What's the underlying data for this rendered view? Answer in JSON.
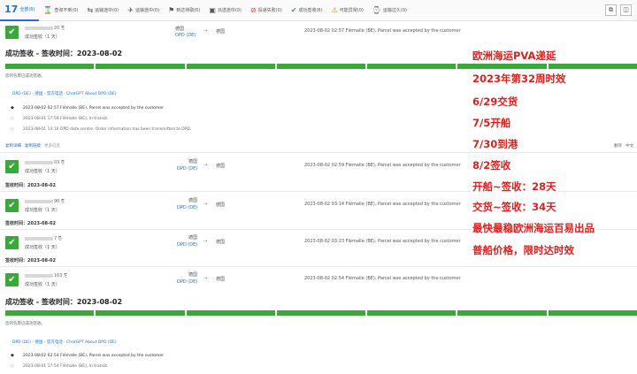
{
  "tabs": [
    {
      "icon": "17",
      "label": "全部(6)",
      "active": true
    },
    {
      "icon": "⌛",
      "label": "查询不到(0)"
    },
    {
      "icon": "⇆",
      "label": "运输途中(0)"
    },
    {
      "icon": "✈",
      "label": "运输途中(0)"
    },
    {
      "icon": "⚑",
      "label": "到达待取(0)"
    },
    {
      "icon": "▣",
      "label": "派送途中(0)"
    },
    {
      "icon": "⊘",
      "label": "投递失败(0)"
    },
    {
      "icon": "✔",
      "label": "成功签收(6)"
    },
    {
      "icon": "⚠",
      "label": "可能异常(0)"
    },
    {
      "icon": "⌚",
      "label": "运输过久(0)"
    }
  ],
  "rows": [
    {
      "num_suffix": "20",
      "status": "成功签收（1 天）",
      "origin": "德国",
      "carrier": "DPD (DE)",
      "dest": "德国",
      "event": "2023-08-02 02:57  Flémalle (BE), Parcel was accepted by the customer"
    },
    {
      "num_suffix": "03",
      "status": "成功签收（1 天）",
      "origin": "德国",
      "carrier": "DPD (DE)",
      "dest": "德国",
      "event": "2023-08-02 02:59  Flémalle (BE), Parcel was accepted by the customer"
    },
    {
      "num_suffix": "90",
      "status": "成功签收（1 天）",
      "origin": "德国",
      "carrier": "DPD (DE)",
      "dest": "德国",
      "event": "2023-08-02 03:14  Flémalle (BE), Parcel was accepted by the customer"
    },
    {
      "num_suffix": "7",
      "status": "成功签收（1 天）",
      "origin": "德国",
      "carrier": "DPD (DE)",
      "dest": "德国",
      "event": "2023-08-02 03:23  Flémalle (BE), Parcel was accepted by the customer"
    },
    {
      "num_suffix": "163",
      "status": "成功签收（1 天）",
      "origin": "德国",
      "carrier": "DPD (DE)",
      "dest": "德国",
      "event": "2023-08-02 02:54  Flémalle (BE), Parcel was accepted by the customer"
    }
  ],
  "section1": {
    "title": "成功签收 - 签收时间：2023-08-02",
    "note": "您的包裹已成功签收。",
    "provider_line": "DPD (DE) - 德国 - 官方电话 · ChatGPT About DPD (DE)",
    "events": [
      "2023-08-02 02:57    Flémalle (BE), Parcel was accepted by the customer",
      "2023-08-01 17:56    Flémalle (BE), In transit.",
      "2023-08-01 13:16    DPD data centre. Order information has been transmitted to DPD."
    ],
    "actions": [
      "复制详细",
      "复制链接",
      "更多信息"
    ],
    "translate": "翻译 · 中文"
  },
  "sign_lines": [
    "签收时间：2023-08-02",
    "签收时间：2023-08-02",
    "签收时间：2023-08-02",
    "签收时间：2023-08-02"
  ],
  "section2": {
    "title": "成功签收 - 签收时间：2023-08-02",
    "note": "您的包裹已成功签收。",
    "provider_line": "DPD (DE) - 德国 - 官方电话 · ChatGPT About DPD (DE)",
    "events": [
      "2023-08-02 02:54    Flémalle (BE), Parcel was accepted by the customer",
      "2023-08-01 17:54    Flémalle (BE), In transit."
    ]
  },
  "promo": [
    "欧洲海运PVA递延",
    "2023年第32周时效",
    "6/29交货",
    "7/5开船",
    "7/30到港",
    "8/2签收",
    "开船~签收：28天",
    "交货~签收：34天",
    "最快最稳欧洲海运百易出品",
    "普船价格，限时达时效"
  ],
  "colors": {
    "accent": "#1e6fd9",
    "success": "#3aa83a",
    "promo": "#e0201a"
  }
}
